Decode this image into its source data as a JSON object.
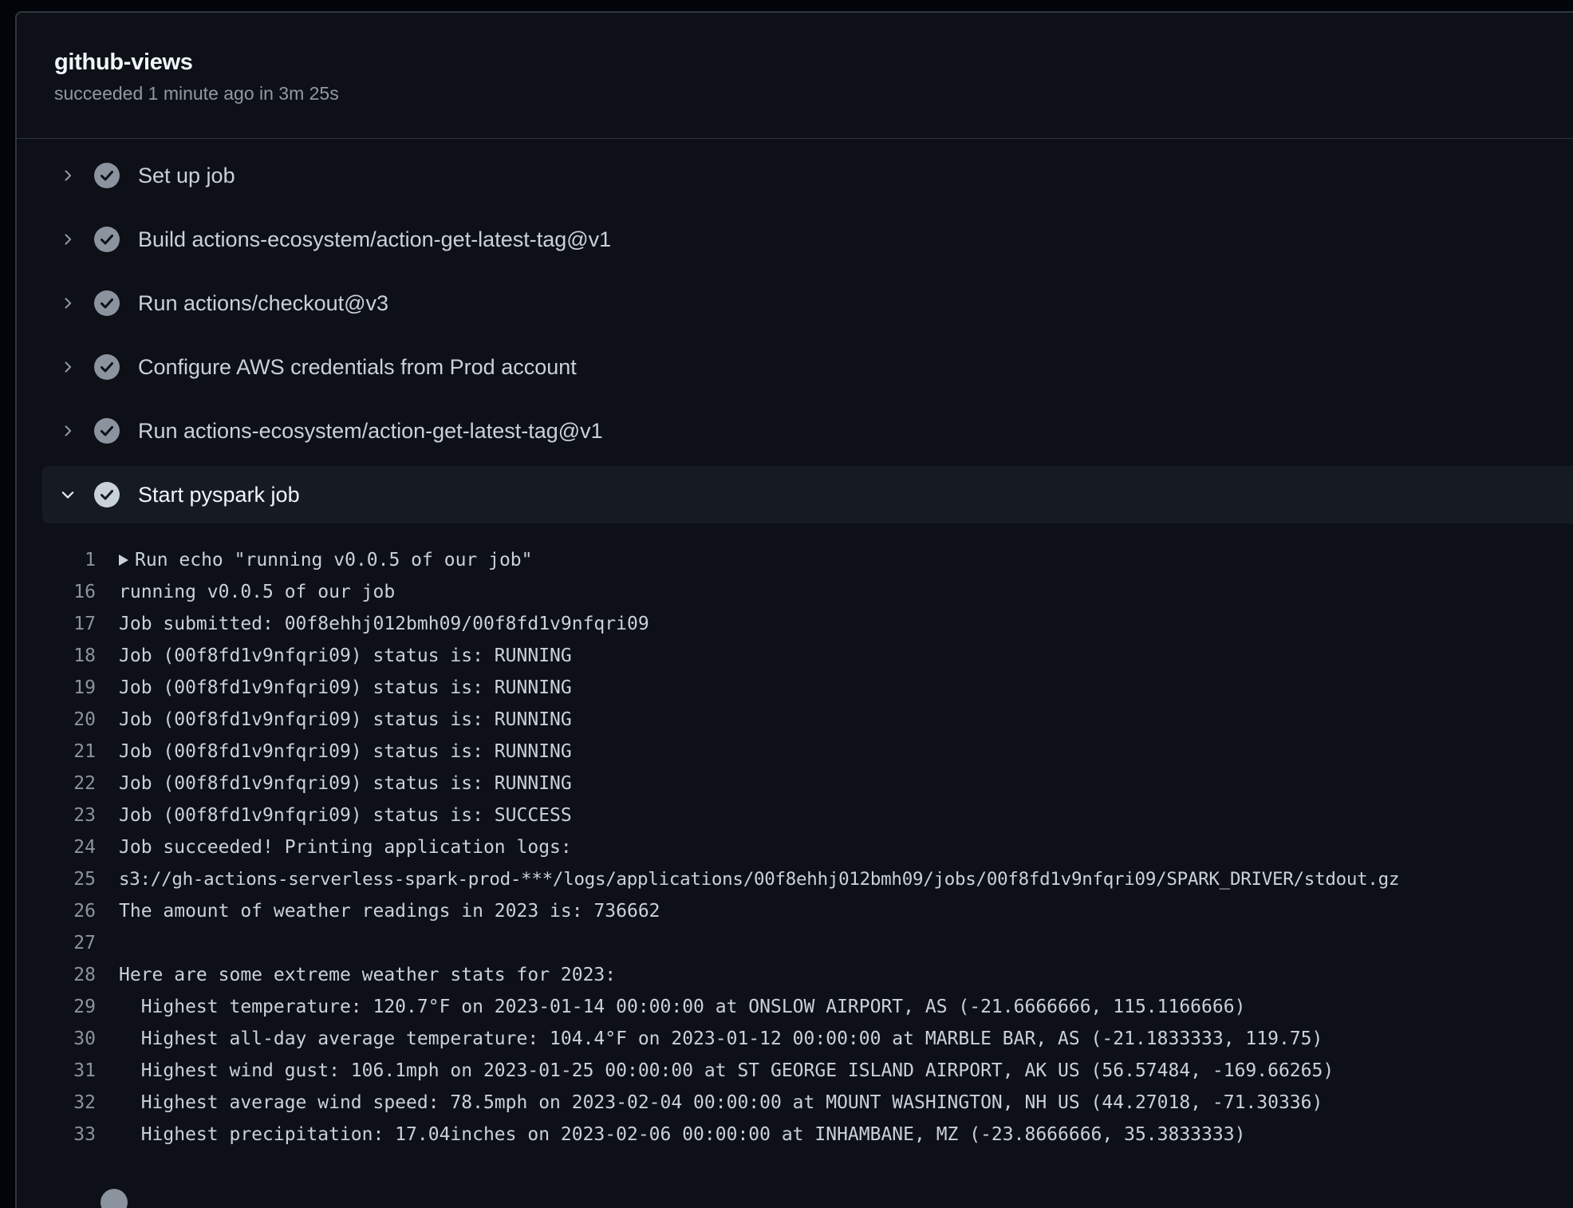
{
  "job": {
    "title": "github-views",
    "status": "succeeded 1 minute ago in 3m 25s"
  },
  "colors": {
    "check_fill": "#8b949e",
    "expanded_bg": "#161b22",
    "border": "#30363d"
  },
  "steps": [
    {
      "label": "Set up job",
      "expanded": false,
      "icon": "check-circle-icon"
    },
    {
      "label": "Build actions-ecosystem/action-get-latest-tag@v1",
      "expanded": false,
      "icon": "check-circle-icon"
    },
    {
      "label": "Run actions/checkout@v3",
      "expanded": false,
      "icon": "check-circle-icon"
    },
    {
      "label": "Configure AWS credentials from Prod account",
      "expanded": false,
      "icon": "check-circle-icon"
    },
    {
      "label": "Run actions-ecosystem/action-get-latest-tag@v1",
      "expanded": false,
      "icon": "check-circle-icon"
    },
    {
      "label": "Start pyspark job",
      "expanded": true,
      "icon": "check-circle-icon"
    }
  ],
  "log": [
    {
      "n": "1",
      "text": "Run echo \"running v0.0.5 of our job\"",
      "collapsible": true
    },
    {
      "n": "16",
      "text": "running v0.0.5 of our job"
    },
    {
      "n": "17",
      "text": "Job submitted: 00f8ehhj012bmh09/00f8fd1v9nfqri09"
    },
    {
      "n": "18",
      "text": "Job (00f8fd1v9nfqri09) status is: RUNNING"
    },
    {
      "n": "19",
      "text": "Job (00f8fd1v9nfqri09) status is: RUNNING"
    },
    {
      "n": "20",
      "text": "Job (00f8fd1v9nfqri09) status is: RUNNING"
    },
    {
      "n": "21",
      "text": "Job (00f8fd1v9nfqri09) status is: RUNNING"
    },
    {
      "n": "22",
      "text": "Job (00f8fd1v9nfqri09) status is: RUNNING"
    },
    {
      "n": "23",
      "text": "Job (00f8fd1v9nfqri09) status is: SUCCESS"
    },
    {
      "n": "24",
      "text": "Job succeeded! Printing application logs:"
    },
    {
      "n": "25",
      "text": "s3://gh-actions-serverless-spark-prod-***/logs/applications/00f8ehhj012bmh09/jobs/00f8fd1v9nfqri09/SPARK_DRIVER/stdout.gz"
    },
    {
      "n": "26",
      "text": "The amount of weather readings in 2023 is: 736662"
    },
    {
      "n": "27",
      "text": ""
    },
    {
      "n": "28",
      "text": "Here are some extreme weather stats for 2023:"
    },
    {
      "n": "29",
      "text": "  Highest temperature: 120.7°F on 2023-01-14 00:00:00 at ONSLOW AIRPORT, AS (-21.6666666, 115.1166666)"
    },
    {
      "n": "30",
      "text": "  Highest all-day average temperature: 104.4°F on 2023-01-12 00:00:00 at MARBLE BAR, AS (-21.1833333, 119.75)"
    },
    {
      "n": "31",
      "text": "  Highest wind gust: 106.1mph on 2023-01-25 00:00:00 at ST GEORGE ISLAND AIRPORT, AK US (56.57484, -169.66265)"
    },
    {
      "n": "32",
      "text": "  Highest average wind speed: 78.5mph on 2023-02-04 00:00:00 at MOUNT WASHINGTON, NH US (44.27018, -71.30336)"
    },
    {
      "n": "33",
      "text": "  Highest precipitation: 17.04inches on 2023-02-06 00:00:00 at INHAMBANE, MZ (-23.8666666, 35.3833333)"
    }
  ]
}
